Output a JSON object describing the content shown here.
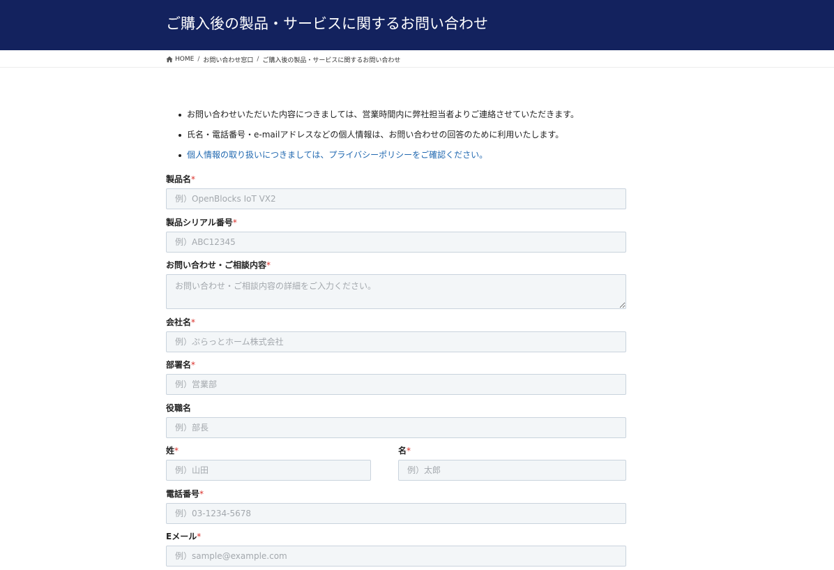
{
  "header": {
    "title": "ご購入後の製品・サービスに関するお問い合わせ"
  },
  "breadcrumb": {
    "home": "HOME",
    "items": [
      "お問い合わせ窓口",
      "ご購入後の製品・サービスに関するお問い合わせ"
    ],
    "separator": "/"
  },
  "notes": [
    "お問い合わせいただいた内容につきましては、営業時間内に弊社担当者よりご連絡させていただきます。",
    "氏名・電話番号・e-mailアドレスなどの個人情報は、お問い合わせの回答のために利用いたします。"
  ],
  "privacy_link": "個人情報の取り扱いにつきましては、プライバシーポリシーをご確認ください。",
  "form": {
    "required_mark": "*",
    "product_name": {
      "label": "製品名",
      "placeholder": "例）OpenBlocks IoT VX2"
    },
    "serial": {
      "label": "製品シリアル番号",
      "placeholder": "例）ABC12345"
    },
    "inquiry": {
      "label": "お問い合わせ・ご相談内容",
      "placeholder": "お問い合わせ・ご相談内容の詳細をご入力ください。"
    },
    "company": {
      "label": "会社名",
      "placeholder": "例）ぷらっとホーム株式会社"
    },
    "department": {
      "label": "部署名",
      "placeholder": "例）営業部"
    },
    "position": {
      "label": "役職名",
      "placeholder": "例）部長"
    },
    "last_name": {
      "label": "姓",
      "placeholder": "例）山田"
    },
    "first_name": {
      "label": "名",
      "placeholder": "例）太郎"
    },
    "phone": {
      "label": "電話番号",
      "placeholder": "例）03-1234-5678"
    },
    "email": {
      "label": "Eメール",
      "placeholder": "例）sample@example.com"
    }
  },
  "colors": {
    "header_bg": "#13225e",
    "link": "#2068b0",
    "required": "#d9302a",
    "input_bg": "#f3f6f8"
  },
  "icons": {
    "home": "home-icon"
  }
}
